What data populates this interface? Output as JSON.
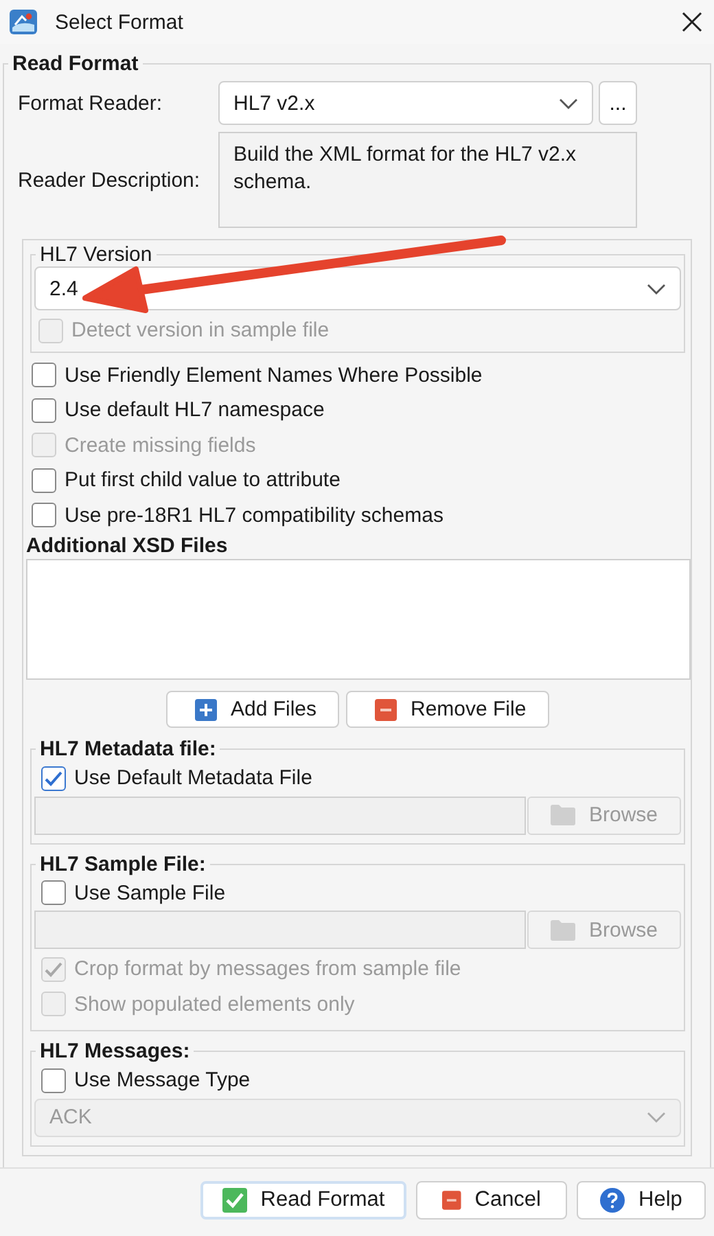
{
  "window": {
    "title": "Select Format"
  },
  "read_format": {
    "heading": "Read Format",
    "format_reader": {
      "label": "Format Reader:",
      "value": "HL7 v2.x",
      "more": "..."
    },
    "reader_description": {
      "label": "Reader Description:",
      "value": "Build the XML format for the HL7 v2.x schema."
    }
  },
  "hl7_version": {
    "heading": "HL7 Version",
    "value": "2.4",
    "detect": {
      "label": "Detect version in sample file",
      "checked": false,
      "disabled": true
    }
  },
  "options": [
    {
      "label": "Use Friendly Element Names Where Possible",
      "checked": false,
      "disabled": false
    },
    {
      "label": "Use default HL7 namespace",
      "checked": false,
      "disabled": false
    },
    {
      "label": "Create missing fields",
      "checked": false,
      "disabled": true
    },
    {
      "label": "Put first child value to attribute",
      "checked": false,
      "disabled": false
    },
    {
      "label": "Use pre-18R1 HL7 compatibility schemas",
      "checked": false,
      "disabled": false
    }
  ],
  "xsd": {
    "heading": "Additional XSD Files",
    "buttons": [
      {
        "label": "Add Files",
        "kind": "add"
      },
      {
        "label": "Remove File",
        "kind": "remove"
      }
    ]
  },
  "metadata": {
    "heading": "HL7 Metadata file:",
    "checks": [
      {
        "label": "Use Default Metadata File",
        "checked": true,
        "disabled": false
      }
    ],
    "browse": {
      "label": "Browse",
      "disabled": true
    }
  },
  "sample": {
    "heading": "HL7 Sample File:",
    "use": {
      "label": "Use Sample File",
      "checked": false,
      "disabled": false
    },
    "browse": {
      "label": "Browse",
      "disabled": true
    },
    "checks": [
      {
        "label": "Crop format by messages from sample file",
        "checked": true,
        "disabled": true
      },
      {
        "label": "Show populated elements only",
        "checked": false,
        "disabled": true
      }
    ]
  },
  "messages": {
    "heading": "HL7 Messages:",
    "checks": [
      {
        "label": "Use Message Type",
        "checked": false,
        "disabled": false
      }
    ],
    "value": "ACK",
    "disabled": true
  },
  "buttons": [
    {
      "label": "Read Format",
      "kind": "ok"
    },
    {
      "label": "Cancel",
      "kind": "cancel"
    },
    {
      "label": "Help",
      "kind": "help"
    }
  ]
}
